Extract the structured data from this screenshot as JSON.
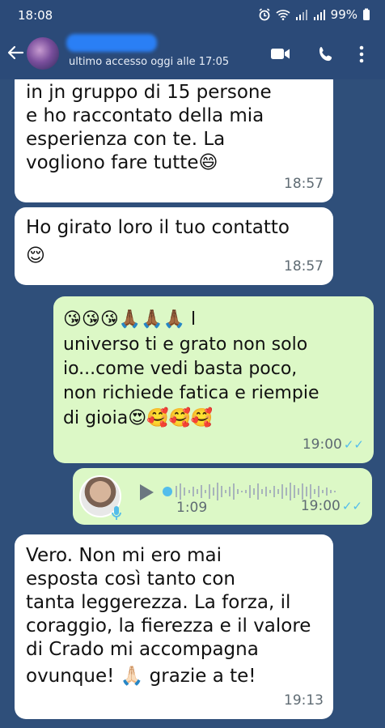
{
  "status_bar": {
    "time": "18:08",
    "battery": "99%"
  },
  "header": {
    "last_seen": "ultimo accesso oggi alle 17:05",
    "icons": [
      "back-arrow-icon",
      "video-call-icon",
      "phone-icon",
      "more-vert-icon"
    ]
  },
  "messages": [
    {
      "type": "incoming",
      "lines": [
        "in jn gruppo di 15 persone",
        "e ho raccontato della mia",
        "esperienza con te. La",
        "vogliono fare tutte😄"
      ],
      "time": "18:57"
    },
    {
      "type": "incoming",
      "lines": [
        "Ho girato loro il tuo contatto",
        "😌"
      ],
      "time": "18:57"
    },
    {
      "type": "outgoing",
      "lines": [
        "😘😘😘🙏🏾🙏🏾🙏🏾 l",
        "universo ti e grato non solo",
        "io...come vedi basta poco,",
        "non richiede fatica e riempie",
        "di gioia😍🥰🥰🥰"
      ],
      "time": "19:00",
      "ticks": "✓✓"
    },
    {
      "type": "voice",
      "duration": "1:09",
      "time": "19:00",
      "ticks": "✓✓"
    },
    {
      "type": "incoming",
      "lines": [
        "Vero. Non mi ero mai",
        "esposta così tanto con",
        "tanta leggerezza. La forza, il",
        "coraggio, la fierezza e il valore",
        "di Crado mi accompagna",
        "ovunque! 🙏🏻 grazie a te!"
      ],
      "time": "19:13"
    }
  ],
  "colors": {
    "header": "#2b4a78",
    "chat_bg": "#2f4f7a",
    "incoming_bubble": "#ffffff",
    "outgoing_bubble": "#dcf8c6",
    "read_ticks": "#53bdeb"
  }
}
